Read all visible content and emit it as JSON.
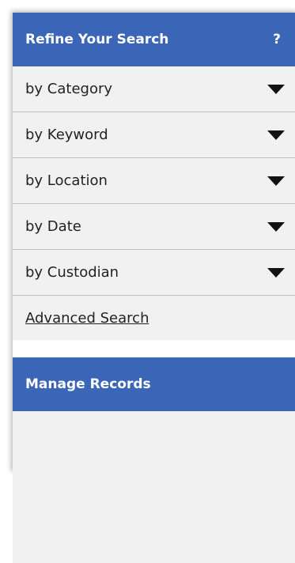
{
  "refine": {
    "title": "Refine Your Search",
    "help": "?",
    "filters": [
      {
        "label": "by Category"
      },
      {
        "label": "by Keyword"
      },
      {
        "label": "by Location"
      },
      {
        "label": "by Date"
      },
      {
        "label": "by Custodian"
      }
    ],
    "advanced_link": "Advanced Search"
  },
  "manage": {
    "title": "Manage Records"
  },
  "colors": {
    "header_blue": "#3b65b7",
    "panel_bg": "#f1f1f1"
  }
}
